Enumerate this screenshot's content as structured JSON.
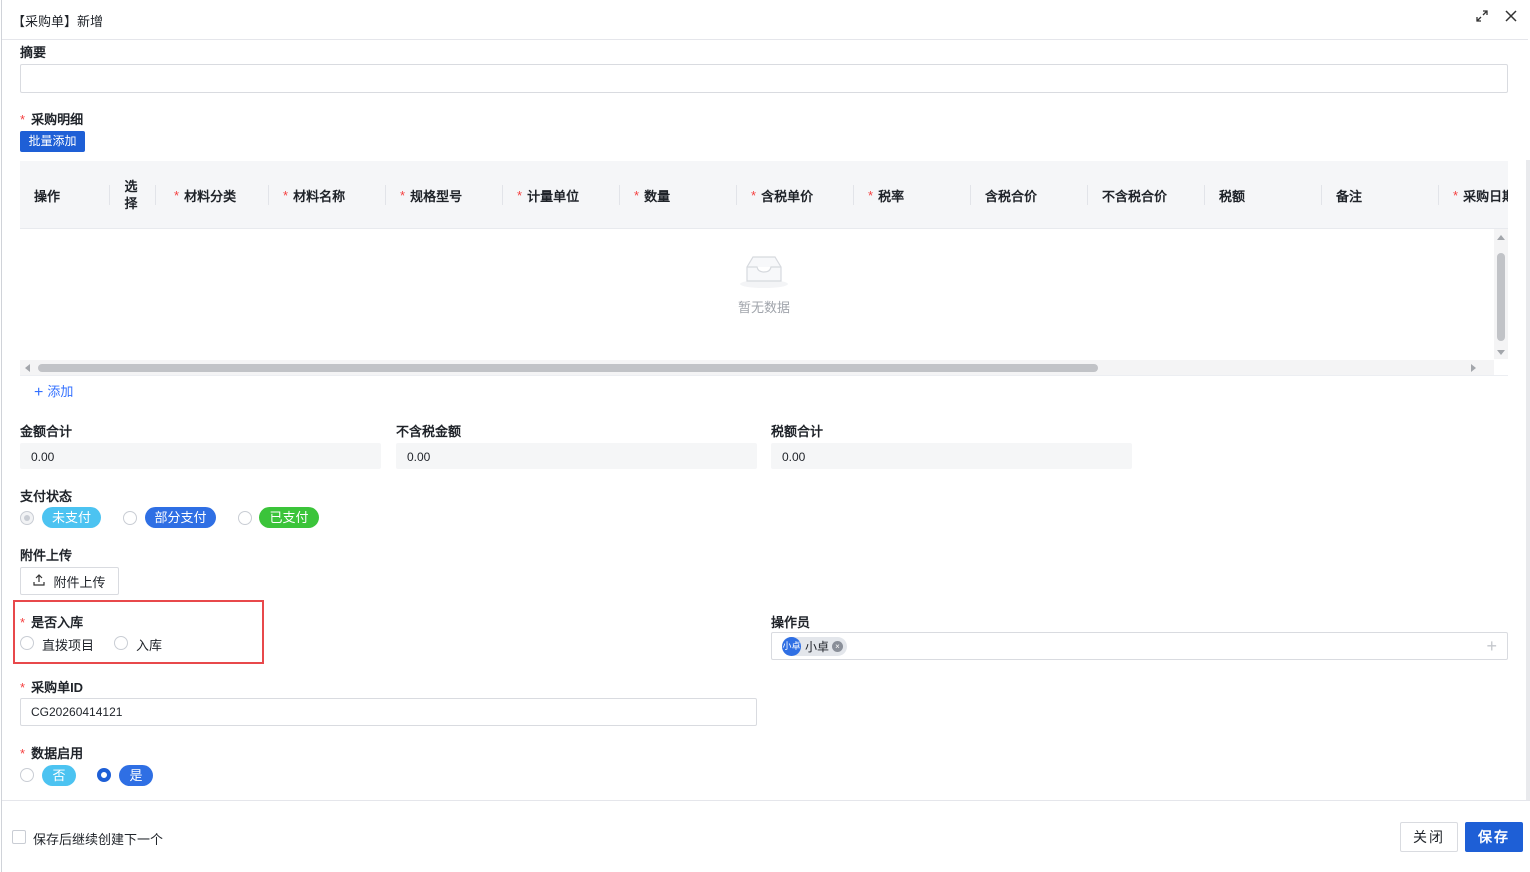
{
  "window": {
    "title": "【采购单】新增",
    "expand_icon": "expand-icon",
    "close_icon": "close-icon"
  },
  "summary": {
    "label": "摘要",
    "value": ""
  },
  "details": {
    "label": "采购明细",
    "batch_add": "批量添加",
    "columns": [
      {
        "label": "操作",
        "required": false
      },
      {
        "label": "选择",
        "required": false
      },
      {
        "label": "材料分类",
        "required": true
      },
      {
        "label": "材料名称",
        "required": true
      },
      {
        "label": "规格型号",
        "required": true
      },
      {
        "label": "计量单位",
        "required": true
      },
      {
        "label": "数量",
        "required": true
      },
      {
        "label": "含税单价",
        "required": true
      },
      {
        "label": "税率",
        "required": true
      },
      {
        "label": "含税合价",
        "required": false
      },
      {
        "label": "不含税合价",
        "required": false
      },
      {
        "label": "税额",
        "required": false
      },
      {
        "label": "备注",
        "required": false
      },
      {
        "label": "采购日期",
        "required": true
      }
    ],
    "select_col_line1": "选",
    "select_col_line2": "择",
    "empty_text": "暂无数据",
    "add_link": "添加"
  },
  "totals": {
    "amount_label": "金额合计",
    "amount_value": "0.00",
    "pretax_label": "不含税金额",
    "pretax_value": "0.00",
    "tax_label": "税额合计",
    "tax_value": "0.00"
  },
  "payment": {
    "label": "支付状态",
    "options": [
      {
        "label": "未支付",
        "color": "#4cc3f1"
      },
      {
        "label": "部分支付",
        "color": "#2f6fe4"
      },
      {
        "label": "已支付",
        "color": "#3bc43a"
      }
    ]
  },
  "attachment": {
    "label": "附件上传",
    "button": "附件上传"
  },
  "warehouse": {
    "label": "是否入库",
    "options": [
      "直拨项目",
      "入库"
    ]
  },
  "operator": {
    "label": "操作员",
    "avatar_text": "小卓",
    "name": "小卓"
  },
  "order_id": {
    "label": "采购单ID",
    "value": "CG20260414121"
  },
  "enabled": {
    "label": "数据启用",
    "options": [
      {
        "label": "否",
        "color": "#4cc3f1"
      },
      {
        "label": "是",
        "color": "#2f6fe4"
      }
    ]
  },
  "footer": {
    "continue_label": "保存后继续创建下一个",
    "close_button": "关闭",
    "save_button": "保存"
  },
  "colors": {
    "primary": "#1e5fd6",
    "required": "#f53f3f",
    "highlight_border": "#e8484b",
    "link": "#3370ff"
  }
}
